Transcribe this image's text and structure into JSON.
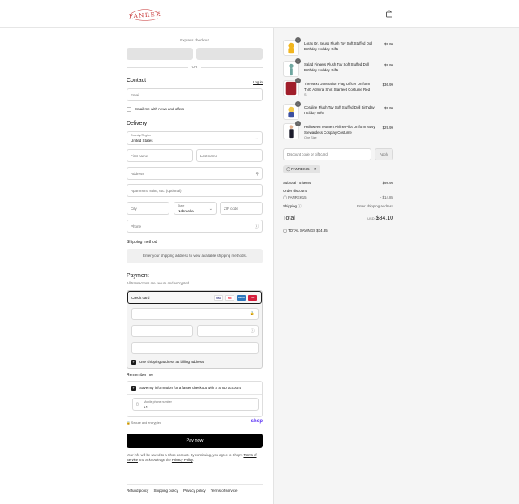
{
  "header": {
    "logo_text": "FANREK",
    "bag_icon": "shopping-bag-icon"
  },
  "express": {
    "label": "Express checkout",
    "or": "OR"
  },
  "contact": {
    "title": "Contact",
    "login": "Log in",
    "email_placeholder": "Email",
    "news_label": "Email me with news and offers"
  },
  "delivery": {
    "title": "Delivery",
    "country_label": "Country/Region",
    "country_value": "United States",
    "first_name": "First name",
    "last_name": "Last name",
    "address": "Address",
    "apartment": "Apartment, suite, etc. (optional)",
    "city": "City",
    "state_label": "State",
    "state_value": "Nebraska",
    "zip": "ZIP code",
    "phone": "Phone"
  },
  "shipping_method": {
    "title": "Shipping method",
    "message": "Enter your shipping address to view available shipping methods."
  },
  "payment": {
    "title": "Payment",
    "subtitle": "All transactions are secure and encrypted.",
    "credit_card": "Credit card",
    "cards": [
      "VISA",
      "MC",
      "AMEX",
      "UP"
    ],
    "billing_label": "Use shipping address as billing address"
  },
  "remember": {
    "title": "Remember me",
    "save_label": "Save my information for a faster checkout with a Shop account",
    "phone_label": "Mobile phone number",
    "phone_value": "+1",
    "secure": "Secure and encrypted",
    "shop": "shop"
  },
  "pay_button": "Pay now",
  "legal": {
    "text": "Your info will be saved to a Shop account. By continuing, you agree to Shop's",
    "terms": "Terms of Service",
    "and": "and acknowledge the",
    "privacy": "Privacy Policy"
  },
  "footer_links": [
    "Refund policy",
    "Shipping policy",
    "Privacy policy",
    "Terms of service"
  ],
  "items": [
    {
      "qty": "1",
      "name": "Lorax Dr. Seuss Plush Toy Soft Stuffed Doll Birthday Holiday Gifts",
      "sub": "",
      "price": "$9.99",
      "color": "#f2b61f"
    },
    {
      "qty": "1",
      "name": "Salad Fingers Plush Toy Soft Stuffed Doll Birthday Holiday Gifts",
      "sub": "",
      "price": "$9.99",
      "color": "#6fa7a0"
    },
    {
      "qty": "1",
      "name": "The Next Generation Flag Officer Uniform TNG Admiral Shirt Starfleet Costume Red",
      "sub": "S",
      "price": "$36.99",
      "color": "#a01d2a"
    },
    {
      "qty": "1",
      "name": "Coraline Plush Toy Soft Stuffed Doll Birthday Holiday Gifts",
      "sub": "",
      "price": "$9.99",
      "color": "#3b4fa0"
    },
    {
      "qty": "1",
      "name": "Halloween Women Airline Pilot Uniform Navy Stewardess Cosplay Costume",
      "sub": "One Size",
      "price": "$29.99",
      "color": "#1c1c2c"
    }
  ],
  "discount": {
    "placeholder": "Discount code or gift card",
    "apply": "Apply",
    "code": "FANREK15"
  },
  "summary": {
    "subtotal_label": "Subtotal · 5 items",
    "subtotal": "$98.95",
    "order_discount": "Order discount",
    "code": "FANREK15",
    "discount_value": "- $14.85",
    "shipping_label": "Shipping",
    "shipping_value": "Enter shipping address",
    "total_label": "Total",
    "currency": "USD",
    "total": "$84.10",
    "savings_label": "TOTAL SAVINGS",
    "savings": "$14.85"
  }
}
